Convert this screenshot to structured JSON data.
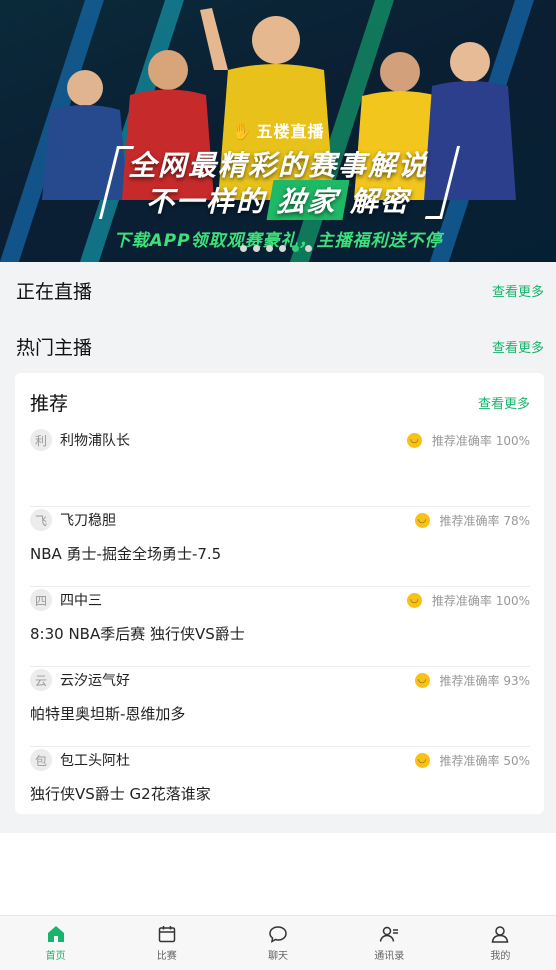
{
  "banner": {
    "logo_text": "五楼直播",
    "headline_line1": "全网最精彩的赛事解说",
    "headline_line2_pre": "不一样的",
    "headline_line2_highlight": "独家",
    "headline_line2_post": "解密",
    "tagline": "下载APP领取观赛豪礼，主播福利送不停",
    "carousel_pages": 6,
    "carousel_active_index": 4
  },
  "sections": {
    "live": {
      "title": "正在直播",
      "more": "查看更多"
    },
    "hot_anchors": {
      "title": "热门主播",
      "more": "查看更多"
    }
  },
  "recommend": {
    "title": "推荐",
    "more": "查看更多",
    "items": [
      {
        "avatar": "利",
        "name": "利物浦队长",
        "rate": "推荐准确率 100%",
        "content": ""
      },
      {
        "avatar": "飞",
        "name": "飞刀稳胆",
        "rate": "推荐准确率 78%",
        "content": "NBA 勇士-掘金全场勇士-7.5"
      },
      {
        "avatar": "四",
        "name": "四中三",
        "rate": "推荐准确率 100%",
        "content": "8:30 NBA季后赛 独行侠VS爵士"
      },
      {
        "avatar": "云",
        "name": "云汐运气好",
        "rate": "推荐准确率 93%",
        "content": "帕特里奥坦斯-恩维加多"
      },
      {
        "avatar": "包",
        "name": "包工头阿杜",
        "rate": "推荐准确率 50%",
        "content": "独行侠VS爵士 G2花落谁家"
      }
    ]
  },
  "tabbar": {
    "tabs": [
      {
        "label": "首页",
        "icon": "home-icon",
        "active": true
      },
      {
        "label": "比赛",
        "icon": "calendar-icon",
        "active": false
      },
      {
        "label": "聊天",
        "icon": "chat-bubble-icon",
        "active": false
      },
      {
        "label": "通讯录",
        "icon": "contacts-icon",
        "active": false
      },
      {
        "label": "我的",
        "icon": "profile-icon",
        "active": false
      }
    ]
  },
  "colors": {
    "accent": "#19b36b",
    "background": "#f2f3f5"
  }
}
